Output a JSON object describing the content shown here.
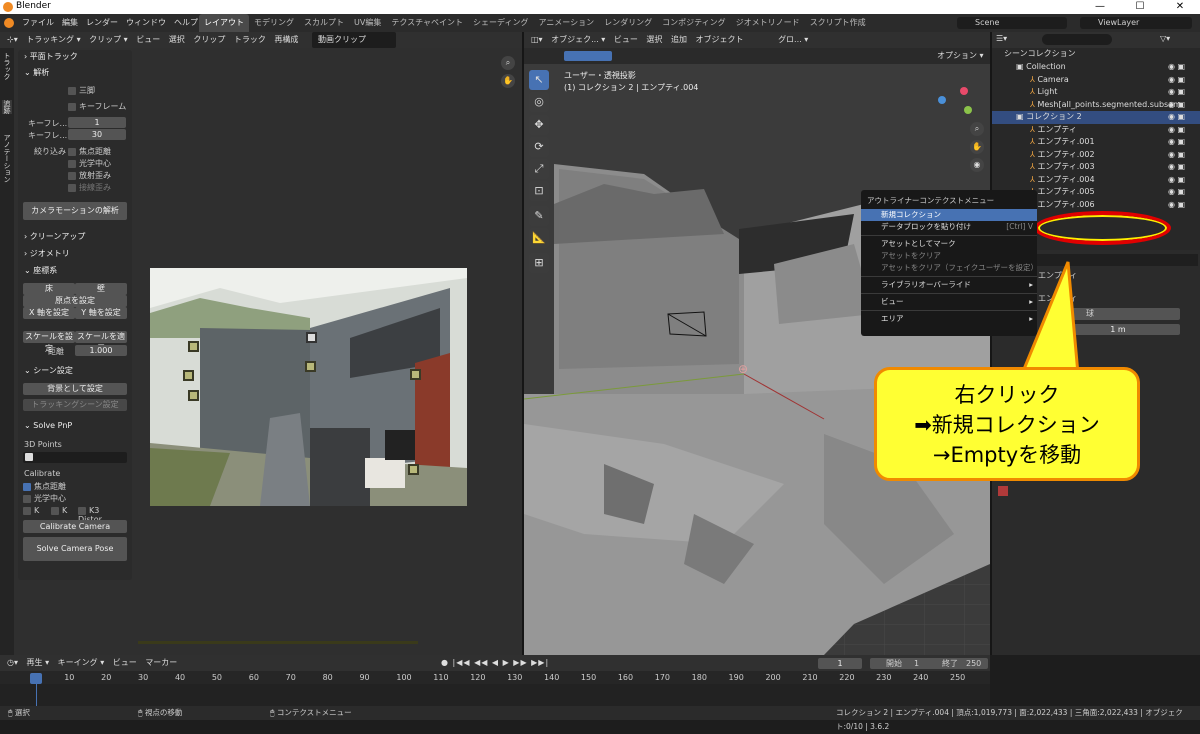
{
  "app": {
    "title": "Blender",
    "window_controls": [
      "—",
      "☐",
      "✕"
    ]
  },
  "menus": [
    "ファイル",
    "編集",
    "レンダー",
    "ウィンドウ",
    "ヘルプ"
  ],
  "workspaces": [
    "レイアウト",
    "モデリング",
    "スカルプト",
    "UV編集",
    "テクスチャペイント",
    "シェーディング",
    "アニメーション",
    "レンダリング",
    "コンポジティング",
    "ジオメトリノード",
    "スクリプト作成"
  ],
  "active_workspace": "レイアウト",
  "scene": {
    "name": "Scene",
    "viewlayer": "ViewLayer"
  },
  "clip": {
    "mode": "トラッキング",
    "clip_menu": "クリップ",
    "menus": [
      "ビュー",
      "選択",
      "クリップ",
      "トラック",
      "再構成"
    ],
    "clip_name": "動画クリップ"
  },
  "sidebar_tabs": [
    "トラック",
    "追跡",
    "アノテーション"
  ],
  "tracking_panel": {
    "plane_track": "平面トラック",
    "solve": "解析",
    "tripod": "三脚",
    "keyframe": "キーフレーム",
    "keyframe_a_label": "キーフレ...",
    "keyframe_a": "1",
    "keyframe_b_label": "キーフレ...",
    "keyframe_b": "30",
    "refine_label": "絞り込み",
    "focal": "焦点距離",
    "optical": "光学中心",
    "radial": "放射歪み",
    "tangential": "接線歪み",
    "camera_motion_btn": "カメラモーションの解析",
    "cleanup": "クリーンアップ",
    "geometry": "ジオメトリ",
    "orientation": "座標系",
    "floor": "床",
    "wall": "壁",
    "set_origin": "原点を設定",
    "set_x": "X 軸を設定",
    "set_y": "Y 軸を設定",
    "set_scale": "スケールを設定",
    "apply_scale": "スケールを適用",
    "distance_label": "距離",
    "distance": "1.000",
    "scene_setup": "シーン設定",
    "set_bg": "背景として設定",
    "set_tracking_scene": "トラッキングシーン設定",
    "solve_pnp": "Solve PnP",
    "points_3d": "3D Points",
    "calibrate": "Calibrate",
    "focal2": "焦点距離",
    "optical2": "光学中心",
    "k1": "K",
    "k2": "K",
    "k3": "K3 Distor...",
    "calibrate_btn": "Calibrate Camera",
    "solve_pose_btn": "Solve Camera Pose"
  },
  "viewport": {
    "mode": "オブジェク...",
    "menus": [
      "ビュー",
      "選択",
      "追加",
      "オブジェクト"
    ],
    "transform": "グロ...",
    "options": "オプション",
    "view_label": "ユーザー・透視投影",
    "object_label": "(1) コレクション 2 | エンプティ.004",
    "tools": [
      "↖",
      "◎",
      "✥",
      "⟳",
      "⤢",
      "⊡",
      "✎",
      "📐",
      "⊞"
    ]
  },
  "outliner": {
    "title": "シーンコレクション",
    "rows": [
      {
        "label": "Collection",
        "indent": 1,
        "selected": false
      },
      {
        "label": "Camera",
        "indent": 2,
        "selected": false
      },
      {
        "label": "Light",
        "indent": 2,
        "selected": false
      },
      {
        "label": "Mesh[all_points.segmented.subsam",
        "indent": 2,
        "selected": false
      },
      {
        "label": "コレクション 2",
        "indent": 1,
        "selected": true
      },
      {
        "label": "エンプティ",
        "indent": 2,
        "selected": false
      },
      {
        "label": "エンプティ.001",
        "indent": 2,
        "selected": false
      },
      {
        "label": "エンプティ.002",
        "indent": 2,
        "selected": false
      },
      {
        "label": "エンプティ.003",
        "indent": 2,
        "selected": false
      },
      {
        "label": "エンプティ.004",
        "indent": 2,
        "selected": false
      },
      {
        "label": "エンプティ.005",
        "indent": 2,
        "selected": false
      },
      {
        "label": "エンプティ.006",
        "indent": 2,
        "selected": false
      }
    ]
  },
  "properties": {
    "name": "エンプティ",
    "display": "球",
    "size": "1 m",
    "section": "エンプティ"
  },
  "context_menu": {
    "title": "アウトライナーコンテクストメニュー",
    "items": [
      {
        "label": "新規コレクション",
        "highlight": true,
        "disabled": false,
        "sub": false,
        "sep_after": false,
        "shortcut": ""
      },
      {
        "label": "データブロックを貼り付け",
        "highlight": false,
        "disabled": false,
        "sub": false,
        "sep_after": true,
        "shortcut": "[Ctrl] V"
      },
      {
        "label": "アセットとしてマーク",
        "highlight": false,
        "disabled": false,
        "sub": false,
        "sep_after": false,
        "shortcut": ""
      },
      {
        "label": "アセットをクリア",
        "highlight": false,
        "disabled": true,
        "sub": false,
        "sep_after": false,
        "shortcut": ""
      },
      {
        "label": "アセットをクリア（フェイクユーザーを設定）",
        "highlight": false,
        "disabled": true,
        "sub": false,
        "sep_after": true,
        "shortcut": ""
      },
      {
        "label": "ライブラリオーバーライド",
        "highlight": false,
        "disabled": false,
        "sub": true,
        "sep_after": true,
        "shortcut": ""
      },
      {
        "label": "ビュー",
        "highlight": false,
        "disabled": false,
        "sub": true,
        "sep_after": true,
        "shortcut": ""
      },
      {
        "label": "エリア",
        "highlight": false,
        "disabled": false,
        "sub": true,
        "sep_after": false,
        "shortcut": ""
      }
    ]
  },
  "callout": {
    "line1": "右クリック",
    "line2": "➡新規コレクション",
    "line3": "→Emptyを移動"
  },
  "timeline": {
    "menus": [
      "再生",
      "キーイング",
      "ビュー",
      "マーカー"
    ],
    "current": "1",
    "start_label": "開始",
    "start": "1",
    "end_label": "終了",
    "end": "250",
    "ticks": [
      "1",
      "10",
      "20",
      "30",
      "40",
      "50",
      "60",
      "70",
      "80",
      "90",
      "100",
      "110",
      "120",
      "130",
      "140",
      "150",
      "160",
      "170",
      "180",
      "190",
      "200",
      "210",
      "220",
      "230",
      "240",
      "250"
    ]
  },
  "statusbar": {
    "select": "選択",
    "rotate": "視点の移動",
    "context": "コンテクストメニュー",
    "info": "コレクション 2 | エンプティ.004 | 頂点:1,019,773 | 面:2,022,433 | 三角面:2,022,433 | オブジェクト:0/10 | 3.6.2"
  },
  "colors": {
    "accent": "#4772b3",
    "callout_fill": "#ffff33",
    "callout_border": "#f08a00",
    "ellipse": "#e00000"
  }
}
